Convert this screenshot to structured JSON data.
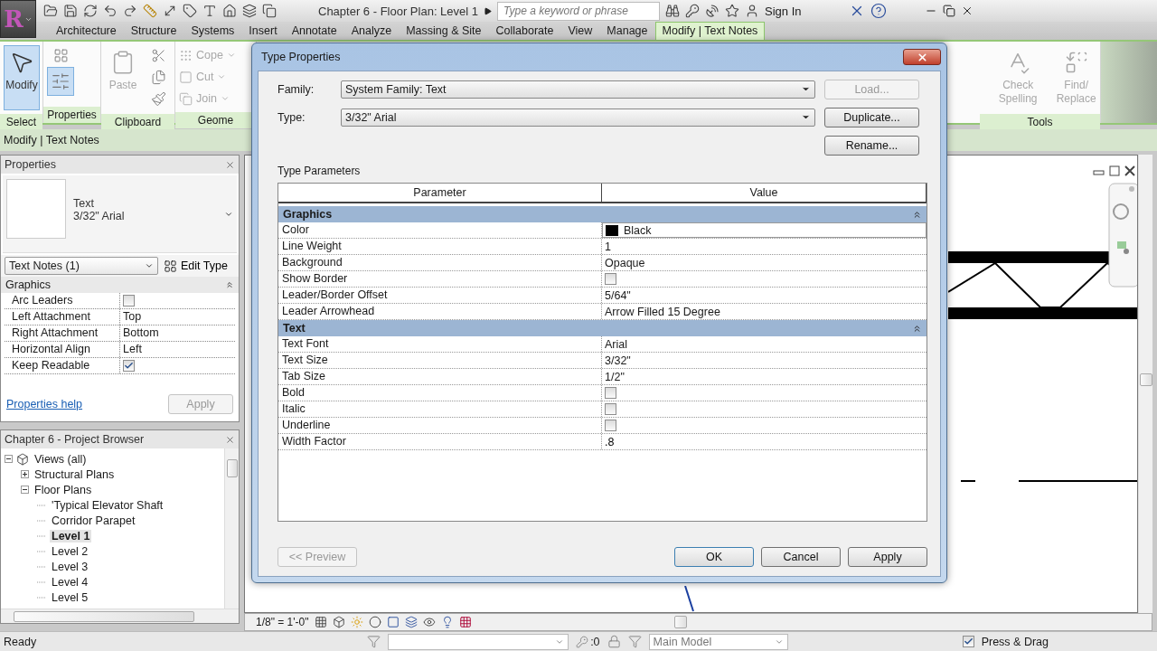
{
  "app": {
    "logo": "R",
    "title": "Chapter 6 - Floor Plan: Level 1",
    "search_placeholder": "Type a keyword or phrase",
    "sign_in": "Sign In"
  },
  "ribbon_tabs": [
    {
      "label": "Architecture",
      "selected": false
    },
    {
      "label": "Structure",
      "selected": false
    },
    {
      "label": "Systems",
      "selected": false
    },
    {
      "label": "Insert",
      "selected": false
    },
    {
      "label": "Annotate",
      "selected": false
    },
    {
      "label": "Analyze",
      "selected": false
    },
    {
      "label": "Massing & Site",
      "selected": false
    },
    {
      "label": "Collaborate",
      "selected": false
    },
    {
      "label": "View",
      "selected": false
    },
    {
      "label": "Manage",
      "selected": false
    },
    {
      "label": "Modify | Text Notes",
      "selected": true
    }
  ],
  "ribbon_panels": [
    {
      "title": "Select",
      "tools": [
        {
          "kind": "large",
          "label": "Modify",
          "selected": true,
          "disabled": false
        }
      ]
    },
    {
      "title": "Properties",
      "tools": [
        {
          "kind": "icon",
          "selected": false,
          "disabled": false
        },
        {
          "kind": "icon",
          "selected": true,
          "disabled": false
        }
      ]
    },
    {
      "title": "Clipboard",
      "tools": [
        {
          "kind": "large",
          "label": "Paste",
          "selected": false,
          "disabled": true
        },
        {
          "kind": "icon",
          "selected": false,
          "disabled": false
        },
        {
          "kind": "icon",
          "selected": false,
          "disabled": false
        },
        {
          "kind": "icon",
          "selected": false,
          "disabled": false
        }
      ]
    },
    {
      "title": "Geome",
      "tools": [
        {
          "kind": "small",
          "label": "Cope",
          "disabled": true
        },
        {
          "kind": "small",
          "label": "Cut",
          "disabled": true
        },
        {
          "kind": "small",
          "label": "Join",
          "disabled": true
        }
      ]
    }
  ],
  "tools_panel": {
    "title": "Tools",
    "tools": [
      {
        "kind": "large",
        "label": "Check Spelling",
        "selected": false,
        "disabled": true
      },
      {
        "kind": "large",
        "label": "Find/\nReplace",
        "selected": false,
        "disabled": true
      }
    ]
  },
  "context_bar": "Modify | Text Notes",
  "properties": {
    "title": "Properties",
    "type_name": "Text",
    "type_value": "3/32\" Arial",
    "filter": "Text Notes (1)",
    "edit_type": "Edit Type",
    "group": "Graphics",
    "rows": [
      {
        "kind": "checkbox",
        "name": "Arc Leaders",
        "checked": false
      },
      {
        "kind": "text",
        "name": "Left Attachment",
        "value": "Top"
      },
      {
        "kind": "text",
        "name": "Right Attachment",
        "value": "Bottom"
      },
      {
        "kind": "text",
        "name": "Horizontal Align",
        "value": "Left"
      },
      {
        "kind": "checkbox",
        "name": "Keep Readable",
        "checked": true
      }
    ],
    "help": "Properties help",
    "apply": {
      "label": "Apply",
      "disabled": true
    }
  },
  "browser": {
    "title": "Chapter 6 - Project Browser",
    "tree": [
      {
        "label": "Views (all)",
        "expanded": true,
        "selected": false,
        "children": [
          {
            "label": "Structural Plans",
            "expanded": false,
            "selected": false
          },
          {
            "label": "Floor Plans",
            "expanded": true,
            "selected": false,
            "children": [
              {
                "label": "'Typical Elevator Shaft",
                "selected": false
              },
              {
                "label": "Corridor Parapet",
                "selected": false
              },
              {
                "label": "Level 1",
                "selected": true
              },
              {
                "label": "Level 2",
                "selected": false
              },
              {
                "label": "Level 3",
                "selected": false
              },
              {
                "label": "Level 4",
                "selected": false
              },
              {
                "label": "Level 5",
                "selected": false
              }
            ]
          }
        ]
      }
    ]
  },
  "view_bar": {
    "scale": "1/8\" = 1'-0\""
  },
  "status": {
    "text": "Ready",
    "count": ":0",
    "model": "Main Model",
    "press_drag": {
      "label": "Press & Drag",
      "checked": true
    }
  },
  "dialog": {
    "title": "Type Properties",
    "fields": [
      {
        "label": "Family:",
        "value": "System Family: Text"
      },
      {
        "label": "Type:",
        "value": "3/32\" Arial"
      }
    ],
    "side_buttons": [
      {
        "label": "Load...",
        "disabled": true
      },
      {
        "label": "Duplicate...",
        "disabled": false
      },
      {
        "label": "Rename...",
        "disabled": false
      }
    ],
    "section": "Type Parameters",
    "columns": [
      "Parameter",
      "Value"
    ],
    "groups": [
      {
        "name": "Graphics",
        "expanded": true,
        "rows": [
          {
            "kind": "color",
            "name": "Color",
            "value": "Black",
            "color": "#000000"
          },
          {
            "kind": "text",
            "name": "Line Weight",
            "value": "1"
          },
          {
            "kind": "text",
            "name": "Background",
            "value": "Opaque"
          },
          {
            "kind": "checkbox",
            "name": "Show Border",
            "checked": false
          },
          {
            "kind": "text",
            "name": "Leader/Border Offset",
            "value": "5/64\""
          },
          {
            "kind": "text",
            "name": "Leader Arrowhead",
            "value": "Arrow Filled 15 Degree"
          }
        ]
      },
      {
        "name": "Text",
        "expanded": true,
        "rows": [
          {
            "kind": "text",
            "name": "Text Font",
            "value": "Arial"
          },
          {
            "kind": "text",
            "name": "Text Size",
            "value": "3/32\""
          },
          {
            "kind": "text",
            "name": "Tab Size",
            "value": "1/2\""
          },
          {
            "kind": "checkbox",
            "name": "Bold",
            "checked": false
          },
          {
            "kind": "checkbox",
            "name": "Italic",
            "checked": false
          },
          {
            "kind": "checkbox",
            "name": "Underline",
            "checked": false
          },
          {
            "kind": "edit",
            "name": "Width Factor",
            "value": ".8"
          }
        ]
      }
    ],
    "buttons": [
      {
        "label": "<< Preview",
        "disabled": true,
        "default": false
      },
      {
        "label": "OK",
        "disabled": false,
        "default": true
      },
      {
        "label": "Cancel",
        "disabled": false,
        "default": false
      },
      {
        "label": "Apply",
        "disabled": false,
        "default": false
      }
    ]
  }
}
